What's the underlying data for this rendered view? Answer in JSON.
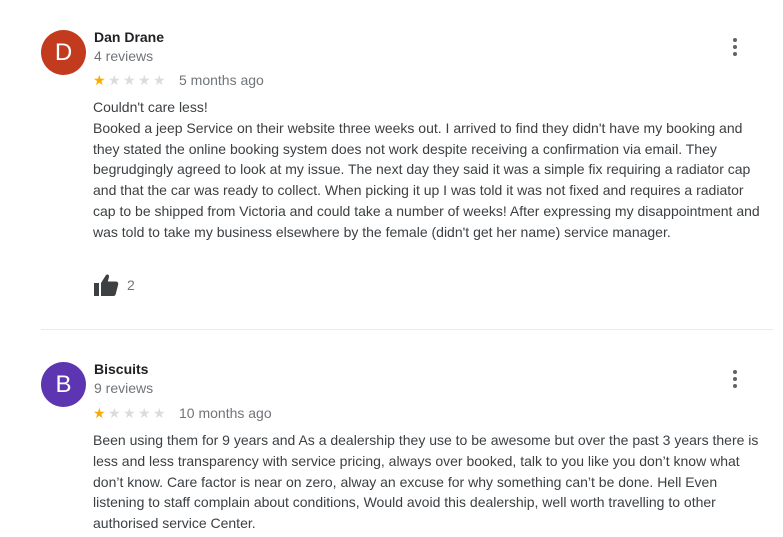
{
  "reviews": [
    {
      "initial": "D",
      "avatar_color": "#c23b1e",
      "name": "Dan Drane",
      "review_count": "4 reviews",
      "rating": 1,
      "max_rating": 5,
      "time": "5 months ago",
      "text": "Couldn't care less!\nBooked a jeep Service on their website three weeks out. I arrived to find they didn't have my booking and they stated the online booking system does not work despite receiving a confirmation via email. They begrudgingly agreed to look at my issue. The next day they said it was a simple fix requiring a radiator cap and that the car was ready to collect. When picking it up I was told it was not fixed and requires a radiator cap to be shipped from Victoria and could take a number of weeks! After expressing my disappointment and was told to take my business elsewhere by the female (didn't get her name) service manager.",
      "likes": "2",
      "icons": {
        "menu": "more-vert-icon",
        "like": "thumb-up-icon"
      }
    },
    {
      "initial": "B",
      "avatar_color": "#5e35b1",
      "name": "Biscuits",
      "review_count": "9 reviews",
      "rating": 1,
      "max_rating": 5,
      "time": "10 months ago",
      "text": "Been using them for 9 years and As a dealership they use to be awesome but over the past 3 years there is less and less transparency with service pricing, always over booked, talk to you like you don’t know what don’t know. Care factor is near on zero, alway an excuse for why something can’t be done. Hell Even listening to staff complain about conditions, Would avoid this dealership, well worth travelling to other authorised service Center.",
      "icons": {
        "menu": "more-vert-icon"
      }
    }
  ]
}
